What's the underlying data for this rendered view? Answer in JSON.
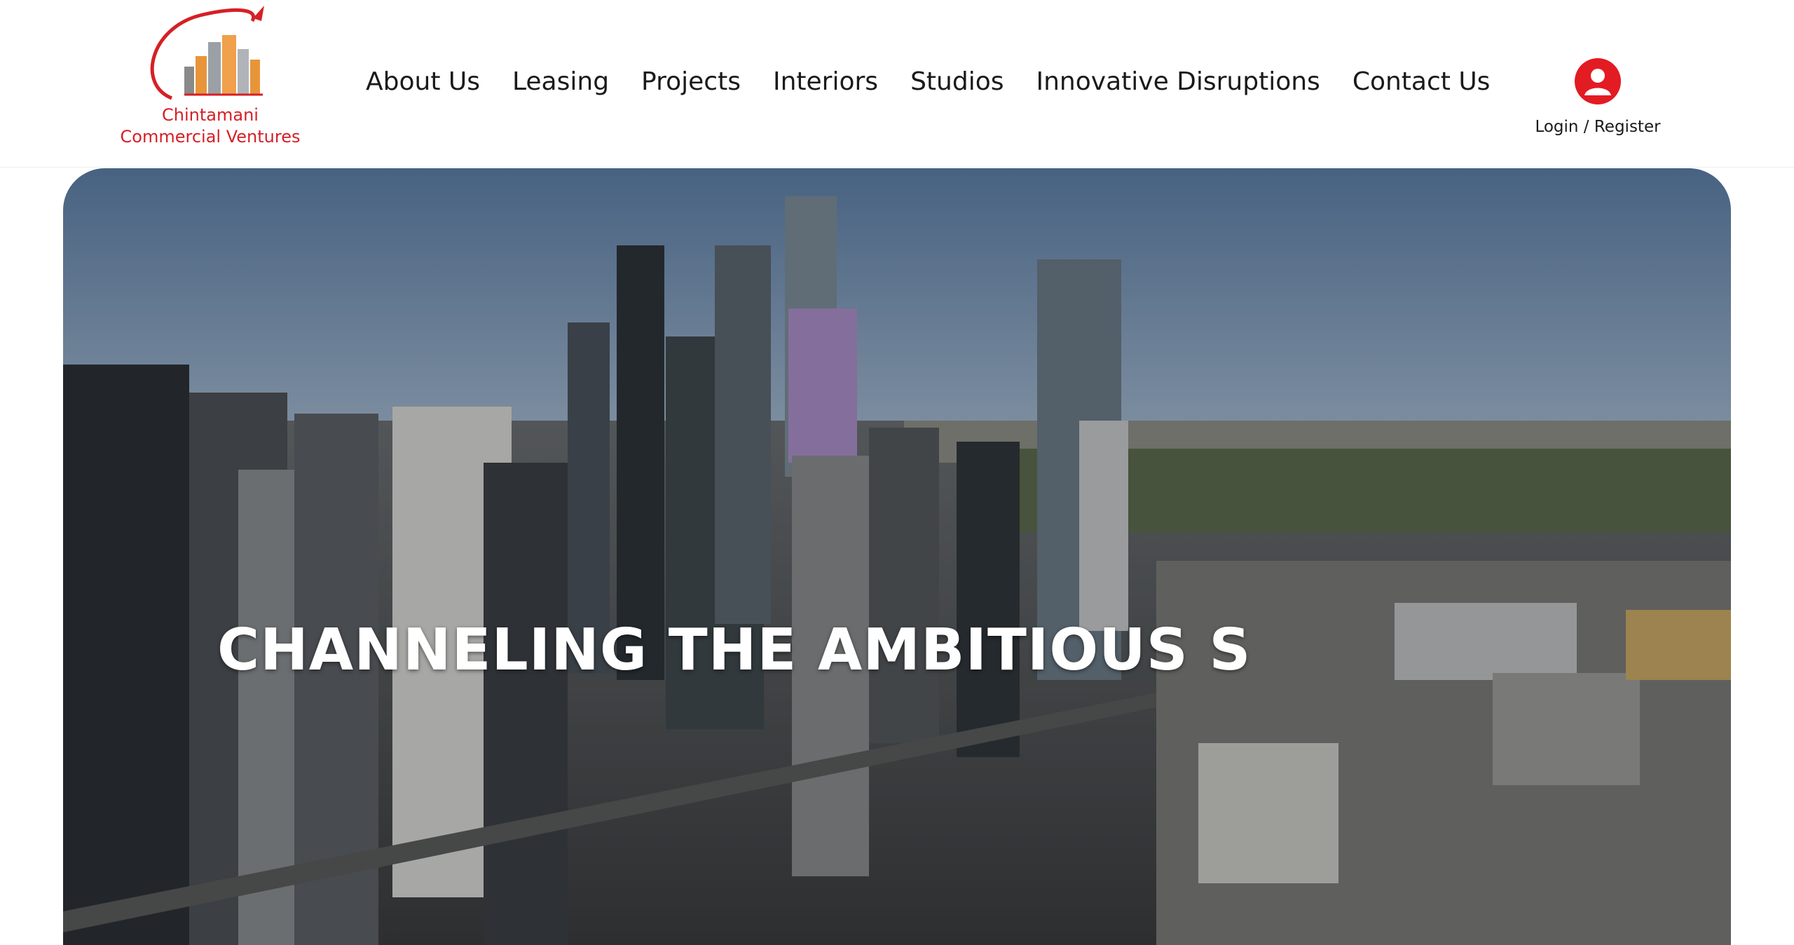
{
  "brand": {
    "name_line1": "Chintamani",
    "name_line2": "Commercial Ventures",
    "brand_color": "#d61f26"
  },
  "nav": {
    "items": [
      {
        "label": "About Us"
      },
      {
        "label": "Leasing"
      },
      {
        "label": "Projects"
      },
      {
        "label": "Interiors"
      },
      {
        "label": "Studios"
      },
      {
        "label": "Innovative Disruptions"
      },
      {
        "label": "Contact Us"
      }
    ]
  },
  "account": {
    "icon": "user-circle-icon",
    "label": "Login / Register",
    "icon_color": "#e31b23"
  },
  "hero": {
    "headline": "CHANNELING THE AMBITIOUS S",
    "background": "aerial city skyline video"
  }
}
